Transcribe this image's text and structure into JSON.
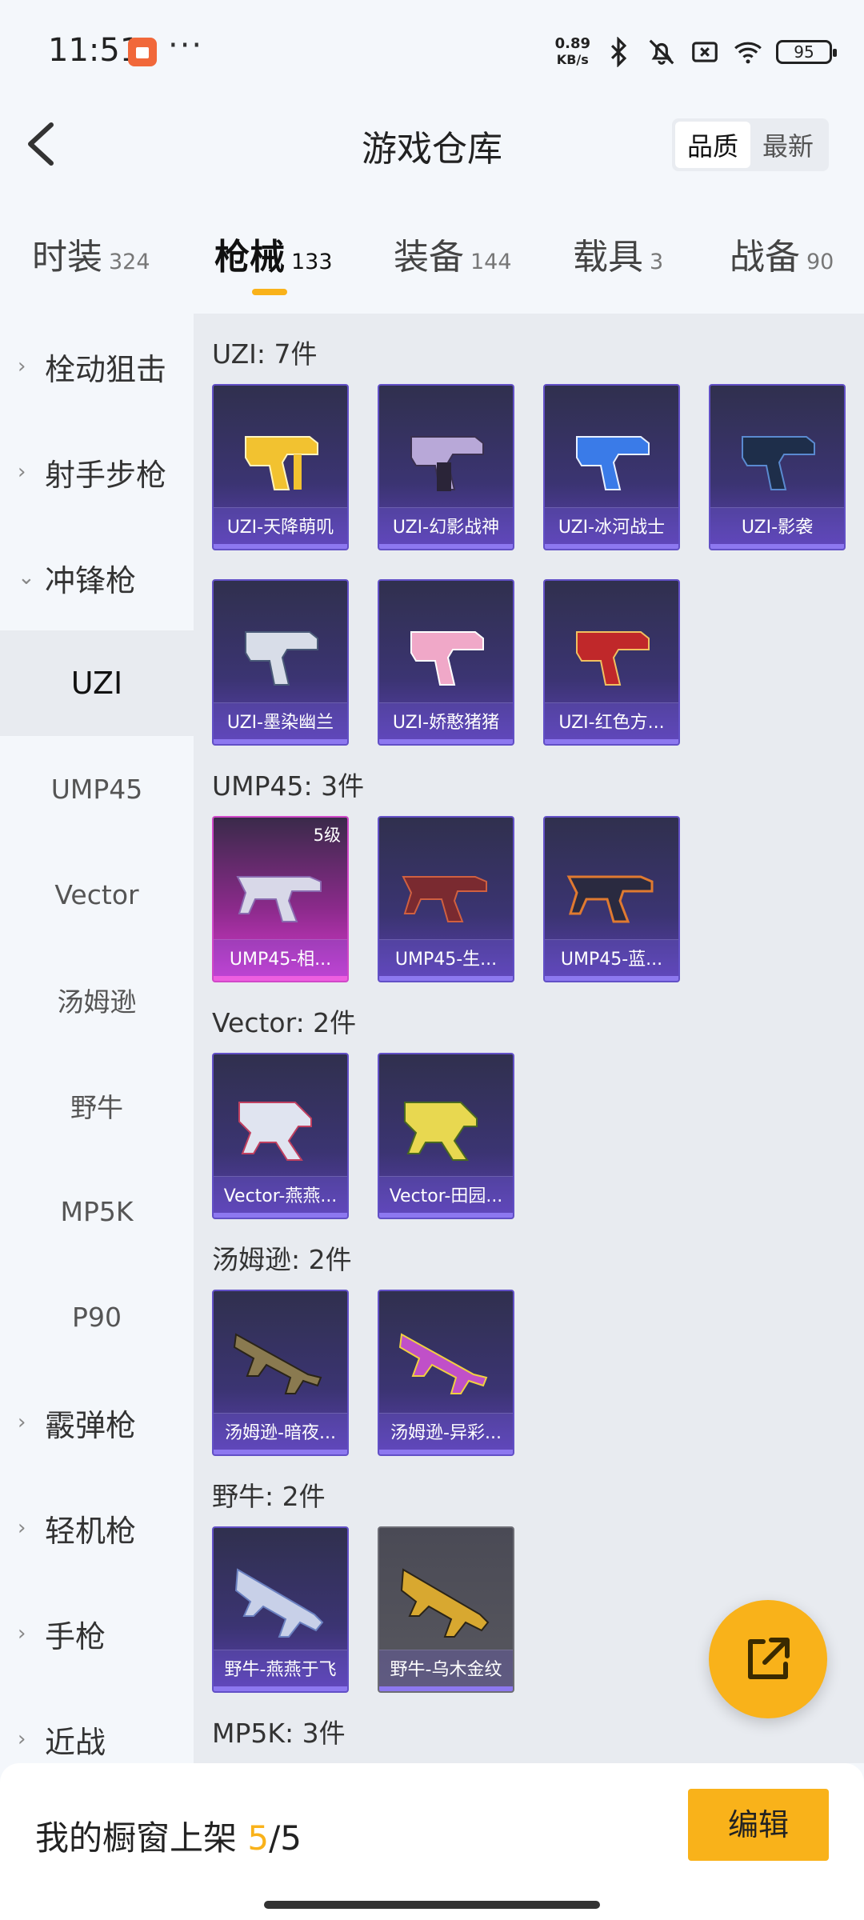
{
  "status_bar": {
    "time": "11:51",
    "net_speed_value": "0.89",
    "net_speed_unit": "KB/s",
    "battery": "95",
    "icons": [
      "app-notification-icon",
      "more-dots-icon",
      "bluetooth-icon",
      "mute-icon",
      "sim-off-icon",
      "wifi-icon",
      "battery-icon"
    ]
  },
  "header": {
    "title": "游戏仓库",
    "sort": {
      "quality": "品质",
      "latest": "最新",
      "selected": "品质"
    }
  },
  "tabs": [
    {
      "label": "时装",
      "count": "324"
    },
    {
      "label": "枪械",
      "count": "133",
      "active": true
    },
    {
      "label": "装备",
      "count": "144"
    },
    {
      "label": "载具",
      "count": "3"
    },
    {
      "label": "战备",
      "count": "90"
    }
  ],
  "sidebar": {
    "groups": [
      {
        "label": "栓动狙击",
        "expanded": false
      },
      {
        "label": "射手步枪",
        "expanded": false
      },
      {
        "label": "冲锋枪",
        "expanded": true
      },
      {
        "label": "霰弹枪",
        "expanded": false
      },
      {
        "label": "轻机枪",
        "expanded": false
      },
      {
        "label": "手枪",
        "expanded": false
      },
      {
        "label": "近战",
        "expanded": false
      }
    ],
    "subitems": [
      "UZI",
      "UMP45",
      "Vector",
      "汤姆逊",
      "野牛",
      "MP5K",
      "P90"
    ],
    "active_sub": "UZI"
  },
  "sections": [
    {
      "title": "UZI: 7件",
      "items": [
        "UZI-天降萌叽",
        "UZI-幻影战神",
        "UZI-冰河战士",
        "UZI-影袭",
        "UZI-墨染幽兰",
        "UZI-娇憨猪猪",
        "UZI-红色方..."
      ]
    },
    {
      "title": "UMP45: 3件",
      "items": [
        "UMP45-相...",
        "UMP45-生...",
        "UMP45-蓝..."
      ],
      "level_badge": "5级"
    },
    {
      "title": "Vector: 2件",
      "items": [
        "Vector-燕燕...",
        "Vector-田园..."
      ]
    },
    {
      "title": "汤姆逊: 2件",
      "items": [
        "汤姆逊-暗夜...",
        "汤姆逊-异彩..."
      ]
    },
    {
      "title": "野牛: 2件",
      "items": [
        "野牛-燕燕于飞",
        "野牛-乌木金纹"
      ]
    },
    {
      "title": "MP5K: 3件",
      "items": []
    }
  ],
  "bottom": {
    "label": "我的橱窗上架 ",
    "count": "5",
    "total": "/5",
    "edit": "编辑"
  },
  "colors": {
    "accent": "#f9b21a",
    "card_purple": "#3b3472",
    "card_pink": "#d93ad0"
  }
}
